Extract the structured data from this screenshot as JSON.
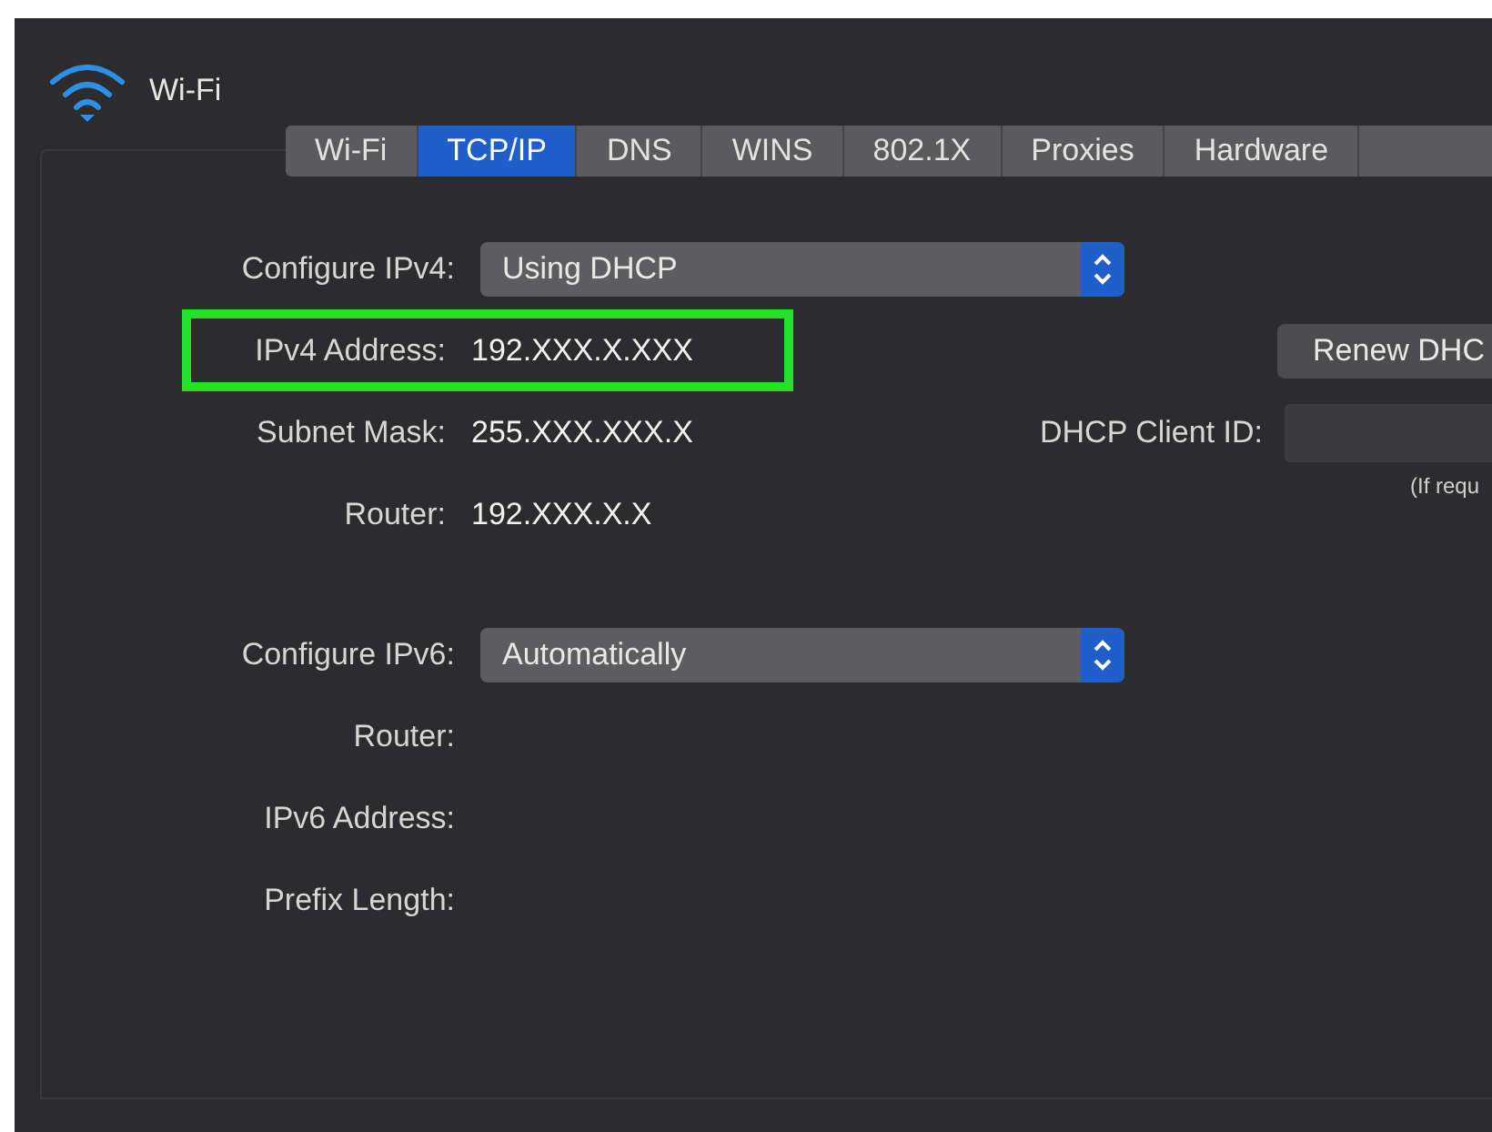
{
  "header": {
    "title": "Wi-Fi"
  },
  "tabs": [
    {
      "label": "Wi-Fi",
      "selected": false
    },
    {
      "label": "TCP/IP",
      "selected": true
    },
    {
      "label": "DNS",
      "selected": false
    },
    {
      "label": "WINS",
      "selected": false
    },
    {
      "label": "802.1X",
      "selected": false
    },
    {
      "label": "Proxies",
      "selected": false
    },
    {
      "label": "Hardware",
      "selected": false
    }
  ],
  "ipv4": {
    "configure": {
      "label": "Configure IPv4:",
      "value": "Using DHCP"
    },
    "rows": [
      {
        "label": "IPv4 Address:",
        "value": "192.XXX.X.XXX",
        "highlighted": true
      },
      {
        "label": "Subnet Mask:",
        "value": "255.XXX.XXX.X",
        "highlighted": false
      },
      {
        "label": "Router:",
        "value": "192.XXX.X.X",
        "highlighted": false
      }
    ]
  },
  "dhcp": {
    "renew_button": "Renew DHC",
    "client_id_label": "DHCP Client ID:",
    "hint": "(If requ"
  },
  "ipv6": {
    "configure": {
      "label": "Configure IPv6:",
      "value": "Automatically"
    },
    "rows": [
      {
        "label": "Router:"
      },
      {
        "label": "IPv6 Address:"
      },
      {
        "label": "Prefix Length:"
      }
    ]
  }
}
